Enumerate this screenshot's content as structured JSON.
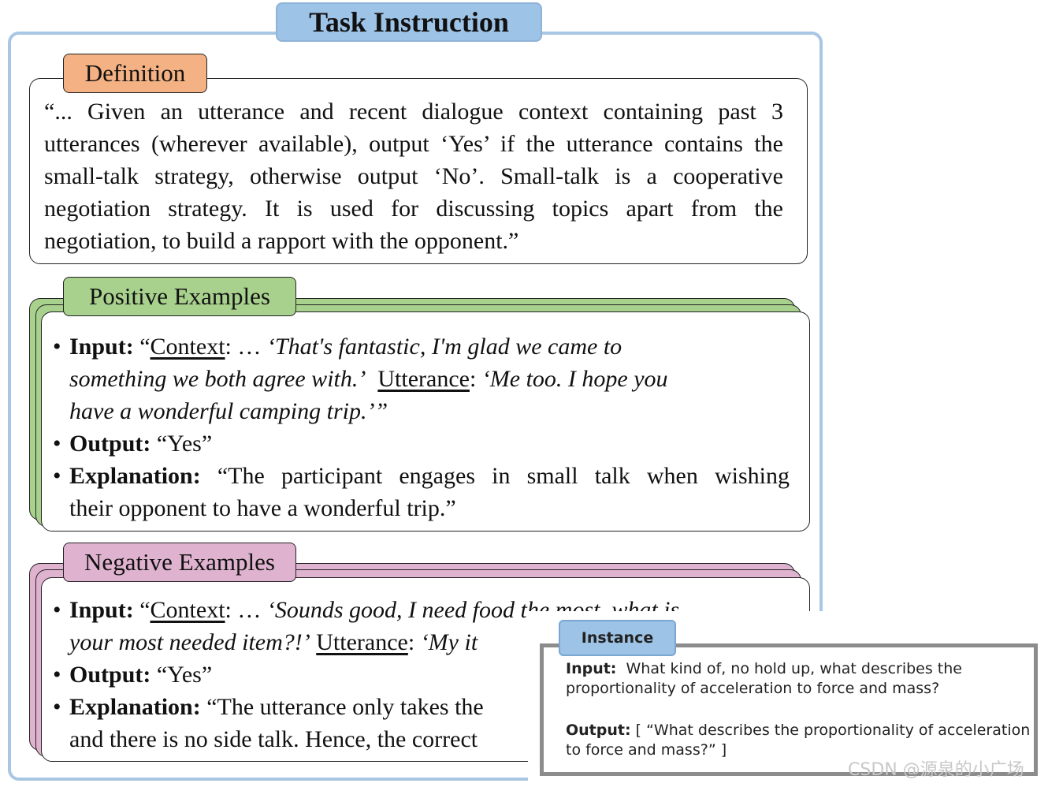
{
  "title": "Task Instruction",
  "definition": {
    "tab_label": "Definition",
    "text": "“... Given an utterance and recent dialogue context containing past 3 utterances (wherever available), output ‘Yes’ if the utterance contains the small-talk strategy, otherwise output ‘No’. Small-talk is a cooperative negotiation strategy. It is used for discussing topics apart from the negotiation, to build a rapport with the opponent.”"
  },
  "positive": {
    "tab_label": "Positive Examples",
    "bullet": "•",
    "input_label": "Input:",
    "open_quote": "“",
    "context_label": "Context",
    "colon_ellipsis": ": …",
    "context_text": "‘That's fantastic, I'm glad we came to",
    "context_text_2": "something we both agree with.’",
    "utterance_label": "Utterance",
    "colon": ":",
    "utterance_text": "‘Me too. I hope you",
    "utterance_text_2": "have a wonderful camping trip.’”",
    "output_label": "Output:",
    "output_value": "“Yes”",
    "explanation_label": "Explanation:",
    "explanation_line1": "“The participant engages in small talk when wishing",
    "explanation_line2": "their opponent to have a wonderful trip.”"
  },
  "negative": {
    "tab_label": "Negative Examples",
    "bullet": "•",
    "input_label": "Input:",
    "open_quote": "“",
    "context_label": "Context",
    "colon_ellipsis": ": …",
    "context_text": "‘Sounds good, I need food the most, what is",
    "context_text_2": "your most needed item?!’",
    "utterance_label": "Utterance",
    "colon": ":",
    "utterance_text": "‘My it",
    "output_label": "Output:",
    "output_value": "“Yes”",
    "explanation_label": "Explanation:",
    "explanation_line1": "“The utterance only takes the",
    "explanation_line2": "and there is no side talk. Hence, the correct"
  },
  "instance": {
    "tab_label": "Instance",
    "input_label": "Input:",
    "input_text_1": "What kind of, no hold up, what describes the",
    "input_text_2": "proportionality of acceleration to force and mass?",
    "output_label": "Output:",
    "output_text_1": "[ “What describes the proportionality of acceleration",
    "output_text_2": "to force and mass?” ]"
  },
  "watermark": "CSDN @源泉的小广场"
}
